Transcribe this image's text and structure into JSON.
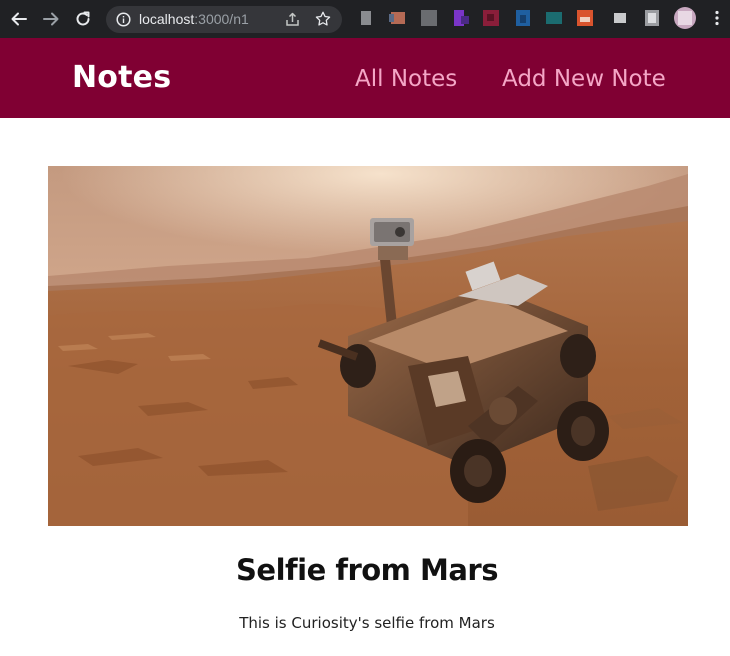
{
  "browser": {
    "url_host": "localhost",
    "url_path": ":3000/n1",
    "back_icon": "arrow-left-icon",
    "forward_icon": "arrow-right-icon",
    "reload_icon": "reload-icon",
    "info_icon": "info-icon",
    "share_icon": "share-icon",
    "bookmark_icon": "star-icon",
    "chrome_color": "#202124"
  },
  "header": {
    "brand": "Notes",
    "nav": [
      {
        "label": "All Notes"
      },
      {
        "label": "Add New Note"
      }
    ],
    "background_color": "#800033",
    "link_color": "#f4a6c6"
  },
  "note": {
    "image_subject": "Curiosity rover selfie on Mars",
    "title": "Selfie from Mars",
    "body": "This is Curiosity's selfie from Mars"
  }
}
